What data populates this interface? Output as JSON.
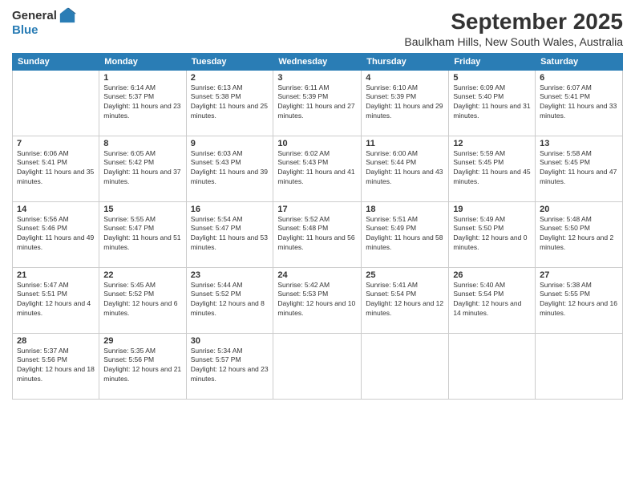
{
  "header": {
    "logo_general": "General",
    "logo_blue": "Blue",
    "month": "September 2025",
    "location": "Baulkham Hills, New South Wales, Australia"
  },
  "days_of_week": [
    "Sunday",
    "Monday",
    "Tuesday",
    "Wednesday",
    "Thursday",
    "Friday",
    "Saturday"
  ],
  "weeks": [
    [
      {
        "day": "",
        "sunrise": "",
        "sunset": "",
        "daylight": ""
      },
      {
        "day": "1",
        "sunrise": "Sunrise: 6:14 AM",
        "sunset": "Sunset: 5:37 PM",
        "daylight": "Daylight: 11 hours and 23 minutes."
      },
      {
        "day": "2",
        "sunrise": "Sunrise: 6:13 AM",
        "sunset": "Sunset: 5:38 PM",
        "daylight": "Daylight: 11 hours and 25 minutes."
      },
      {
        "day": "3",
        "sunrise": "Sunrise: 6:11 AM",
        "sunset": "Sunset: 5:39 PM",
        "daylight": "Daylight: 11 hours and 27 minutes."
      },
      {
        "day": "4",
        "sunrise": "Sunrise: 6:10 AM",
        "sunset": "Sunset: 5:39 PM",
        "daylight": "Daylight: 11 hours and 29 minutes."
      },
      {
        "day": "5",
        "sunrise": "Sunrise: 6:09 AM",
        "sunset": "Sunset: 5:40 PM",
        "daylight": "Daylight: 11 hours and 31 minutes."
      },
      {
        "day": "6",
        "sunrise": "Sunrise: 6:07 AM",
        "sunset": "Sunset: 5:41 PM",
        "daylight": "Daylight: 11 hours and 33 minutes."
      }
    ],
    [
      {
        "day": "7",
        "sunrise": "Sunrise: 6:06 AM",
        "sunset": "Sunset: 5:41 PM",
        "daylight": "Daylight: 11 hours and 35 minutes."
      },
      {
        "day": "8",
        "sunrise": "Sunrise: 6:05 AM",
        "sunset": "Sunset: 5:42 PM",
        "daylight": "Daylight: 11 hours and 37 minutes."
      },
      {
        "day": "9",
        "sunrise": "Sunrise: 6:03 AM",
        "sunset": "Sunset: 5:43 PM",
        "daylight": "Daylight: 11 hours and 39 minutes."
      },
      {
        "day": "10",
        "sunrise": "Sunrise: 6:02 AM",
        "sunset": "Sunset: 5:43 PM",
        "daylight": "Daylight: 11 hours and 41 minutes."
      },
      {
        "day": "11",
        "sunrise": "Sunrise: 6:00 AM",
        "sunset": "Sunset: 5:44 PM",
        "daylight": "Daylight: 11 hours and 43 minutes."
      },
      {
        "day": "12",
        "sunrise": "Sunrise: 5:59 AM",
        "sunset": "Sunset: 5:45 PM",
        "daylight": "Daylight: 11 hours and 45 minutes."
      },
      {
        "day": "13",
        "sunrise": "Sunrise: 5:58 AM",
        "sunset": "Sunset: 5:45 PM",
        "daylight": "Daylight: 11 hours and 47 minutes."
      }
    ],
    [
      {
        "day": "14",
        "sunrise": "Sunrise: 5:56 AM",
        "sunset": "Sunset: 5:46 PM",
        "daylight": "Daylight: 11 hours and 49 minutes."
      },
      {
        "day": "15",
        "sunrise": "Sunrise: 5:55 AM",
        "sunset": "Sunset: 5:47 PM",
        "daylight": "Daylight: 11 hours and 51 minutes."
      },
      {
        "day": "16",
        "sunrise": "Sunrise: 5:54 AM",
        "sunset": "Sunset: 5:47 PM",
        "daylight": "Daylight: 11 hours and 53 minutes."
      },
      {
        "day": "17",
        "sunrise": "Sunrise: 5:52 AM",
        "sunset": "Sunset: 5:48 PM",
        "daylight": "Daylight: 11 hours and 56 minutes."
      },
      {
        "day": "18",
        "sunrise": "Sunrise: 5:51 AM",
        "sunset": "Sunset: 5:49 PM",
        "daylight": "Daylight: 11 hours and 58 minutes."
      },
      {
        "day": "19",
        "sunrise": "Sunrise: 5:49 AM",
        "sunset": "Sunset: 5:50 PM",
        "daylight": "Daylight: 12 hours and 0 minutes."
      },
      {
        "day": "20",
        "sunrise": "Sunrise: 5:48 AM",
        "sunset": "Sunset: 5:50 PM",
        "daylight": "Daylight: 12 hours and 2 minutes."
      }
    ],
    [
      {
        "day": "21",
        "sunrise": "Sunrise: 5:47 AM",
        "sunset": "Sunset: 5:51 PM",
        "daylight": "Daylight: 12 hours and 4 minutes."
      },
      {
        "day": "22",
        "sunrise": "Sunrise: 5:45 AM",
        "sunset": "Sunset: 5:52 PM",
        "daylight": "Daylight: 12 hours and 6 minutes."
      },
      {
        "day": "23",
        "sunrise": "Sunrise: 5:44 AM",
        "sunset": "Sunset: 5:52 PM",
        "daylight": "Daylight: 12 hours and 8 minutes."
      },
      {
        "day": "24",
        "sunrise": "Sunrise: 5:42 AM",
        "sunset": "Sunset: 5:53 PM",
        "daylight": "Daylight: 12 hours and 10 minutes."
      },
      {
        "day": "25",
        "sunrise": "Sunrise: 5:41 AM",
        "sunset": "Sunset: 5:54 PM",
        "daylight": "Daylight: 12 hours and 12 minutes."
      },
      {
        "day": "26",
        "sunrise": "Sunrise: 5:40 AM",
        "sunset": "Sunset: 5:54 PM",
        "daylight": "Daylight: 12 hours and 14 minutes."
      },
      {
        "day": "27",
        "sunrise": "Sunrise: 5:38 AM",
        "sunset": "Sunset: 5:55 PM",
        "daylight": "Daylight: 12 hours and 16 minutes."
      }
    ],
    [
      {
        "day": "28",
        "sunrise": "Sunrise: 5:37 AM",
        "sunset": "Sunset: 5:56 PM",
        "daylight": "Daylight: 12 hours and 18 minutes."
      },
      {
        "day": "29",
        "sunrise": "Sunrise: 5:35 AM",
        "sunset": "Sunset: 5:56 PM",
        "daylight": "Daylight: 12 hours and 21 minutes."
      },
      {
        "day": "30",
        "sunrise": "Sunrise: 5:34 AM",
        "sunset": "Sunset: 5:57 PM",
        "daylight": "Daylight: 12 hours and 23 minutes."
      },
      {
        "day": "",
        "sunrise": "",
        "sunset": "",
        "daylight": ""
      },
      {
        "day": "",
        "sunrise": "",
        "sunset": "",
        "daylight": ""
      },
      {
        "day": "",
        "sunrise": "",
        "sunset": "",
        "daylight": ""
      },
      {
        "day": "",
        "sunrise": "",
        "sunset": "",
        "daylight": ""
      }
    ]
  ]
}
